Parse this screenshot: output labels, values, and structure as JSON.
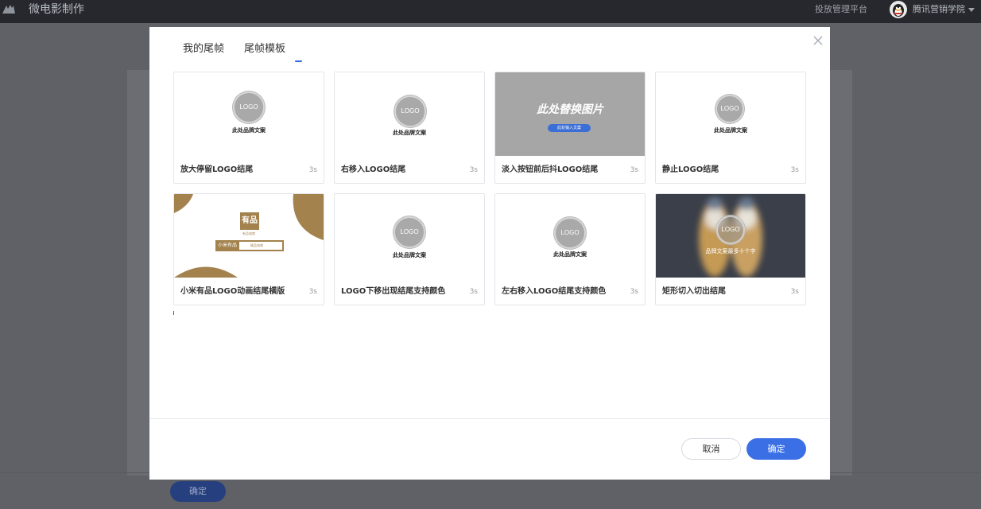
{
  "app": {
    "title": "微电影制作",
    "platform_link": "投放管理平台",
    "user_name": "腾讯营销学院"
  },
  "background_page": {
    "confirm_label": "确定"
  },
  "modal": {
    "tabs": [
      {
        "label": "我的尾帧",
        "active": false
      },
      {
        "label": "尾帧模板",
        "active": true
      }
    ],
    "templates": [
      {
        "name": "放大停留LOGO结尾",
        "duration": "3s",
        "thumb": {
          "logo": "LOGO",
          "brand": "此处品牌文案"
        }
      },
      {
        "name": "右移入LOGO结尾",
        "duration": "3s",
        "thumb": {
          "logo": "LOGO",
          "brand": "此处品牌文案"
        }
      },
      {
        "name": "淡入按钮前后抖LOGO结尾",
        "duration": "3s",
        "thumb": {
          "headline": "此处替换图片",
          "button": "此处输入文案"
        }
      },
      {
        "name": "静止LOGO结尾",
        "duration": "3s",
        "thumb": {
          "logo": "LOGO",
          "brand": "此处品牌文案"
        }
      },
      {
        "name": "小米有品LOGO动画结尾横版",
        "duration": "3s",
        "thumb": {
          "logo": "有品",
          "sub": "有品电商",
          "bar_left": "小米有品",
          "bar_field": "精品电商"
        }
      },
      {
        "name": "LOGO下移出现结尾支持颜色",
        "duration": "3s",
        "thumb": {
          "logo": "LOGO",
          "brand": "此处品牌文案"
        }
      },
      {
        "name": "左右移入LOGO结尾支持颜色",
        "duration": "3s",
        "thumb": {
          "logo": "LOGO",
          "brand": "此处品牌文案"
        }
      },
      {
        "name": "矩形切入切出结尾",
        "duration": "3s",
        "thumb": {
          "logo": "LOGO",
          "brand": "品牌文案最多十个字"
        }
      }
    ],
    "cancel_label": "取消",
    "confirm_label": "确定"
  },
  "colors": {
    "accent": "#3a6fe6",
    "topbar": "#26282d",
    "youpin_brand": "#a3824d"
  }
}
